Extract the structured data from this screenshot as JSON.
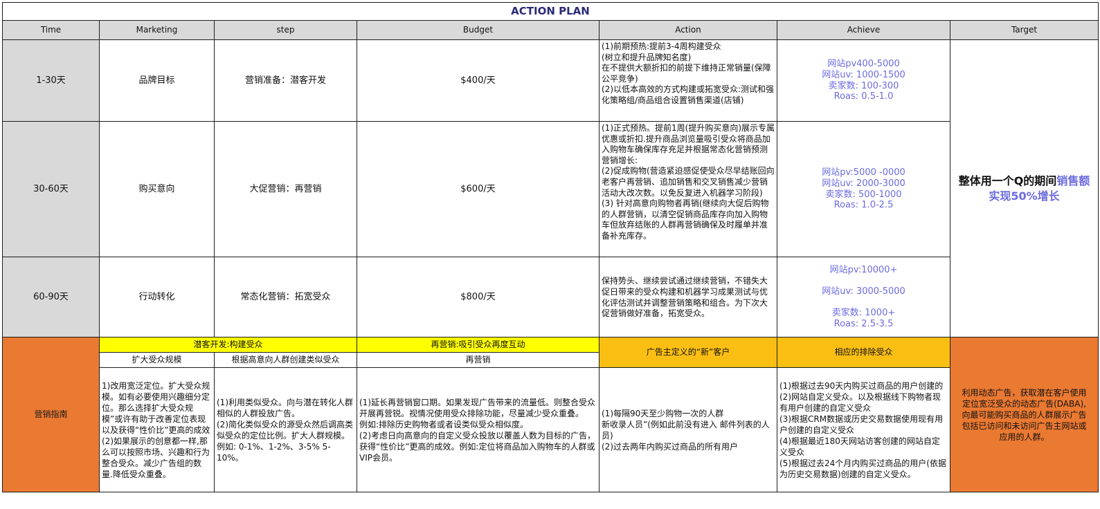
{
  "title": "ACTION PLAN",
  "headers": [
    "Time",
    "Marketing",
    "step",
    "Budget",
    "Action",
    "Achieve",
    "Target"
  ],
  "rows": [
    {
      "time": "1-30天",
      "marketing": "品牌目标",
      "step": "营销准备：潜客开发",
      "budget": "$400/天",
      "action": "(1)前期预热:提前3-4周构建受众\n(树立和提升品牌知名度)\n在不提供大额折扣的前提下维持正常销量(保障公平竞争)\n(2)以低本高效的方式构建或拓宽受众:测试和强化策略组/商品组合设置销售渠道(店铺)",
      "achieve": "网站pv400-5000\n网站uv: 1000-1500\n卖家数: 100-300\nRoas: 0.5-1.0"
    },
    {
      "time": "30-60天",
      "marketing": "购买意向",
      "step": "大促营销：再营销",
      "budget": "$600/天",
      "action": "(1)正式预热。提前1周(提升购买意向)展示专属优惠或折扣.提升商品浏览量吸引受众将商品加入购物车确保库存充足并根据常态化营销预测营销增长:\n(2)促成购物(营造紧迫感促使受众尽早结账回向老客户再营销、追加销售和交叉销售减少营销活动大改次数。以免反复进入机器学习阶段)\n(3) 针对高意向购物者再销(继续向大促后购物的人群营销，以清空促销商品库存向加入购物车但放弃结账的人群再营销确保及时履单并准备补充库存。",
      "achieve": "网站pv:5000 -0000\n网站uv: 2000-3000\n卖家数: 500-1000\nRoas: 1.0-2.5"
    },
    {
      "time": "60-90天",
      "marketing": "行动转化",
      "step": "常态化营销：拓宽受众",
      "budget": "$800/天",
      "action": "保持势头、继续尝试通过继续营销，不错失大促日带来的受众构建和机器学习成果测试与优化评估测试并调整营销策略和组合。为下次大促营销做好准备，拓宽受众。",
      "achieve": "网站pv:10000+\n\n网站uv: 3000-5000\n\n卖家数: 1000+\nRoas: 2.5-3.5"
    }
  ],
  "target": {
    "text_black": "整体用一个Q的期间",
    "text_highlight": "销售额实现50%增长"
  },
  "guide": {
    "label": "营销指南",
    "yellow1": "潜客开发:构建受众",
    "yellow2": "再营销:吸引受众再度互动",
    "amber1": "广告主定义的“新”客户",
    "amber2": "相应的排除受众",
    "sub1": "扩大受众规模",
    "sub2": "根据高意向人群创建类似受众",
    "sub3": "再营销",
    "col1": "1)改用宽泛定位。扩大受众规模。如有必要使用兴趣细分定位。那么选择扩大受众规模”或许有助于改善定位表现以及获得“性价比”更高的成效\n(2)如果展示的创意都一样,那么可以按照市场、兴趣和行为整合受众。减少广告组的数量.降低受众重叠。",
    "col2": "(1)利用类似受众。向与潜在转化人群相似的人群投放广告。\n(2)简化类似受众的源受众然后调高类似受众的定位比例。扩大人群规模。例如: 0-1%、1-2%、3-5% 5-10%。",
    "col3": "(1)延长再营销窗口期。如果发现广告带来的流量低。则整合受众开展再营锐。视情况使用受众排除功能，尽量减少受众重叠。\n例如:排除历史购物者或者设类似受众相似度。\n(2)考虑日向高意向的自定义受众投放以覆盖人数为目标的广告，获得“性价比”更高的成效。例如:定位将商品加入购物车的人群或VIP会员。",
    "col4": "(1)每隔90天至少购物一次的人群\n新收录人员”(例如此前没有进入 邮件列表的人员)\n(2)过去两年内购买过商品的所有用户",
    "col5": "(1)根据过去90天内购买过商品的用户创建的\n(2)网站自定义受众。以及根据线下购物者现有用户创建的自定义受众\n(3)根据CRM数据或历史交易数据使用现有用户创建的自定义受众\n(4)根据最近180天网站访客创建的网站自定义受众\n(5)根据过去24个月内购买过商品的用户(依据为历史交易数据)创建的自定义受众。",
    "target": "利用动态广告，获取潜在客户使用定位宽泛受众的动态广告(DABA),向最可能购买商品的人群展示广告包括已访问和未访问广告主网站或应用的人群。"
  }
}
